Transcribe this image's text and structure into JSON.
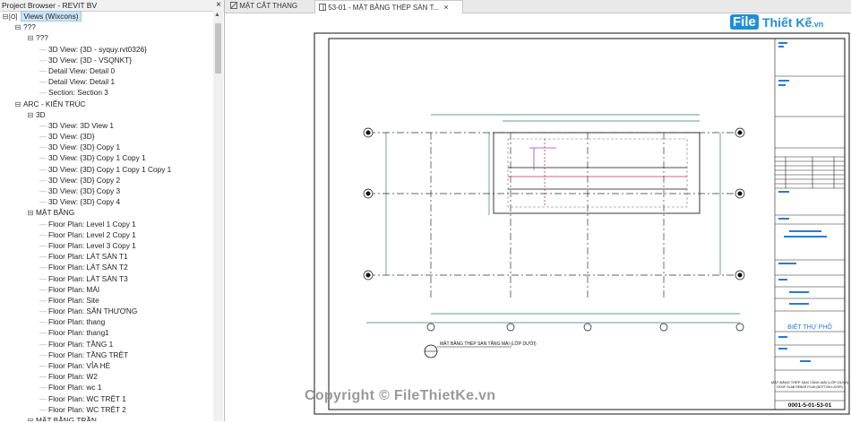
{
  "project_browser": {
    "title": "Project Browser - REVIT BV",
    "close_glyph": "×",
    "nodes": [
      {
        "label": "Views (Wixcons)",
        "depth": 0,
        "toggle": "⊟",
        "selected": true
      },
      {
        "label": "???",
        "depth": 1,
        "toggle": "⊟"
      },
      {
        "label": "???",
        "depth": 2,
        "toggle": "⊟"
      },
      {
        "label": "3D View: {3D - syquy.rvt0326}",
        "depth": 3
      },
      {
        "label": "3D View: {3D - VSQNKT}",
        "depth": 3
      },
      {
        "label": "Detail View: Detail 0",
        "depth": 3
      },
      {
        "label": "Detail View: Detail 1",
        "depth": 3
      },
      {
        "label": "Section: Section 3",
        "depth": 3
      },
      {
        "label": "ARC - KIẾN TRÚC",
        "depth": 1,
        "toggle": "⊟"
      },
      {
        "label": "3D",
        "depth": 2,
        "toggle": "⊟"
      },
      {
        "label": "3D View: 3D View 1",
        "depth": 3
      },
      {
        "label": "3D View: {3D}",
        "depth": 3
      },
      {
        "label": "3D View: {3D} Copy 1",
        "depth": 3
      },
      {
        "label": "3D View: {3D} Copy 1 Copy 1",
        "depth": 3
      },
      {
        "label": "3D View: {3D} Copy 1 Copy 1 Copy 1",
        "depth": 3
      },
      {
        "label": "3D View: {3D} Copy 2",
        "depth": 3
      },
      {
        "label": "3D View: {3D} Copy 3",
        "depth": 3
      },
      {
        "label": "3D View: {3D} Copy 4",
        "depth": 3
      },
      {
        "label": "MẶT BẰNG",
        "depth": 2,
        "toggle": "⊟"
      },
      {
        "label": "Floor Plan: Level 1 Copy 1",
        "depth": 3
      },
      {
        "label": "Floor Plan: Level 2 Copy 1",
        "depth": 3
      },
      {
        "label": "Floor Plan: Level 3 Copy 1",
        "depth": 3
      },
      {
        "label": "Floor Plan: LÁT SÀN T1",
        "depth": 3
      },
      {
        "label": "Floor Plan: LÁT SÀN T2",
        "depth": 3
      },
      {
        "label": "Floor Plan: LÁT SÀN T3",
        "depth": 3
      },
      {
        "label": "Floor Plan: MÁI",
        "depth": 3
      },
      {
        "label": "Floor Plan: Site",
        "depth": 3
      },
      {
        "label": "Floor Plan: SÂN THƯỢNG",
        "depth": 3
      },
      {
        "label": "Floor Plan: thang",
        "depth": 3
      },
      {
        "label": "Floor Plan: thang1",
        "depth": 3
      },
      {
        "label": "Floor Plan: TẦNG 1",
        "depth": 3
      },
      {
        "label": "Floor Plan: TẦNG TRỆT",
        "depth": 3
      },
      {
        "label": "Floor Plan: VỈA HÈ",
        "depth": 3
      },
      {
        "label": "Floor Plan: W2",
        "depth": 3
      },
      {
        "label": "Floor Plan: wc 1",
        "depth": 3
      },
      {
        "label": "Floor Plan: WC TRỆT 1",
        "depth": 3
      },
      {
        "label": "Floor Plan: WC TRỆT 2",
        "depth": 3
      },
      {
        "label": "MẶT BẰNG TRẦN",
        "depth": 2,
        "toggle": "⊟"
      }
    ]
  },
  "tabs": [
    {
      "label": "MẶT CẮT THANG",
      "active": false,
      "close": ""
    },
    {
      "label": "53-01 - MẶT BẰNG THÉP SÀN T...",
      "active": true,
      "close": "×"
    }
  ],
  "drawing": {
    "plan_title": "MẶT BẰNG THÉP SÀN TẦNG MÁI (LỚP DƯỚI)",
    "sheet_project": "BIỆT THỰ PHỐ",
    "sheet_title_vn": "MẶT BẰNG THÉP SÀN TẦNG MÁI (LỚP DƯỚI)",
    "sheet_title_en": "ROOF SLAB REBAR PLAN (BOTTOM LAYER)",
    "sheet_number": "0001-5-01-53-01"
  },
  "watermark": "Copyright © FileThietKe.vn",
  "logo": {
    "file": "File",
    "rest": "Thiết Kế",
    "vn": ".vn"
  },
  "colors": {
    "accent": "#1e8fd6",
    "selection": "#cce4f7"
  }
}
